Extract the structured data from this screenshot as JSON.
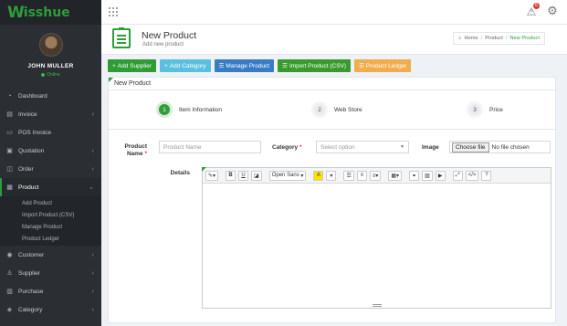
{
  "app": {
    "logo_w": "W",
    "logo_text": "isshue"
  },
  "user": {
    "name": "JOHN MULLER",
    "status": "Online"
  },
  "sidebar": {
    "items": [
      {
        "label": "Dashboard",
        "icon": "dashboard-icon",
        "chevron": ""
      },
      {
        "label": "Invoice",
        "icon": "invoice-icon",
        "chevron": "‹"
      },
      {
        "label": "POS Invoice",
        "icon": "pos-icon",
        "chevron": ""
      },
      {
        "label": "Quotation",
        "icon": "quotation-icon",
        "chevron": "‹"
      },
      {
        "label": "Order",
        "icon": "order-icon",
        "chevron": "‹"
      },
      {
        "label": "Product",
        "icon": "product-icon",
        "chevron": "⌄"
      },
      {
        "label": "Customer",
        "icon": "customer-icon",
        "chevron": "‹"
      },
      {
        "label": "Supplier",
        "icon": "supplier-icon",
        "chevron": "‹"
      },
      {
        "label": "Purchase",
        "icon": "purchase-icon",
        "chevron": "‹"
      },
      {
        "label": "Category",
        "icon": "category-icon",
        "chevron": "‹"
      }
    ],
    "product_submenu": [
      "Add Product",
      "Import Product (CSV)",
      "Manage Product",
      "Product Ledger"
    ]
  },
  "topbar": {
    "notification_count": "6"
  },
  "header": {
    "title": "New Product",
    "subtitle": "Add new product",
    "breadcrumb": {
      "home": "Home",
      "section": "Product",
      "current": "New Product"
    }
  },
  "actions": {
    "add_supplier": "Add Supplier",
    "add_category": "Add Category",
    "manage_product": "Manage Product",
    "import_product": "Import Product (CSV)",
    "product_ledger": "Product Ledger"
  },
  "card": {
    "title": "New Product"
  },
  "steps": [
    {
      "num": "1",
      "label": "Item Information"
    },
    {
      "num": "2",
      "label": "Web Store"
    },
    {
      "num": "3",
      "label": "Price"
    }
  ],
  "form": {
    "product_name_label_1": "Product",
    "product_name_label_2": "Name",
    "product_name_placeholder": "Product Name",
    "category_label": "Category",
    "category_value": "Select option",
    "image_label": "Image",
    "choose_file": "Choose file",
    "no_file": "No file chosen",
    "details_label": "Details"
  },
  "editor_toolbar": {
    "font_name": "Open Sans"
  },
  "colors": {
    "accent": "#2e9d3a",
    "sidebar_bg": "#2b2f34"
  }
}
